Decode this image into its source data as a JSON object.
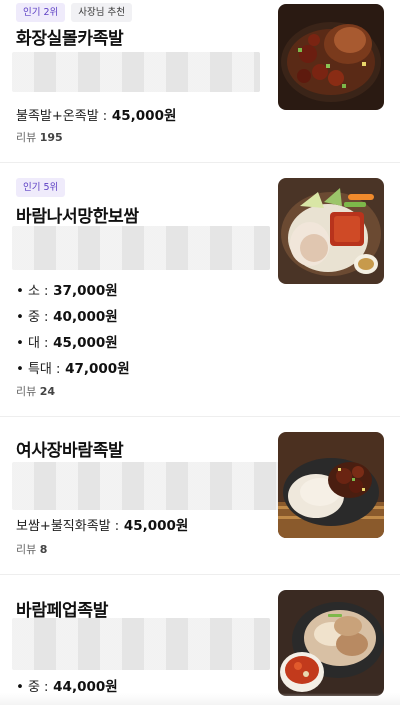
{
  "menu_items": [
    {
      "badges": [
        "인기 2위",
        "사장님 추천"
      ],
      "name": "화장실몰카족발",
      "prices": [
        {
          "label": "불족발+온족발 :",
          "value": "45,000원"
        }
      ],
      "review_label": "리뷰",
      "review_count": "195",
      "image": "braised-jokbal-platter"
    },
    {
      "badges": [
        "인기 5위"
      ],
      "name": "바람나서망한보쌈",
      "prices": [
        {
          "label": "소 :",
          "value": "37,000원"
        },
        {
          "label": "중 :",
          "value": "40,000원"
        },
        {
          "label": "대 :",
          "value": "45,000원"
        },
        {
          "label": "특대 :",
          "value": "47,000원"
        }
      ],
      "review_label": "리뷰",
      "review_count": "24",
      "image": "bossam-platter"
    },
    {
      "name": "여사장바람족발",
      "prices": [
        {
          "label": "보쌈+불직화족발 :",
          "value": "45,000원"
        }
      ],
      "review_label": "리뷰",
      "review_count": "8",
      "image": "jokbal-bossam-combo"
    },
    {
      "name": "바람페업족발",
      "prices": [
        {
          "label": "중 :",
          "value": "44,000원"
        }
      ],
      "image": "jokbal-with-kimchi"
    }
  ],
  "colors": {
    "rank_badge_text": "#5c3fc4",
    "rank_badge_bg": "#efebfb",
    "divider": "#eeeeee"
  }
}
